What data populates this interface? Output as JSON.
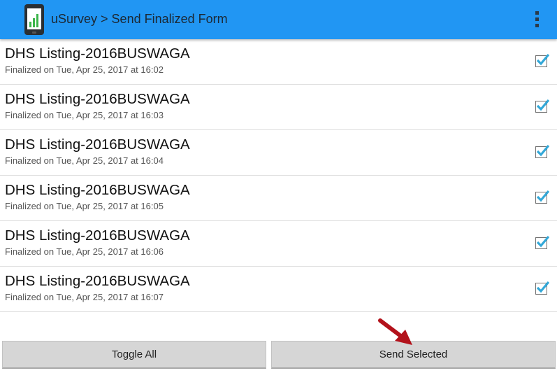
{
  "appbar": {
    "title": "uSurvey > Send Finalized Form",
    "logo_icon": "phone-chart-icon",
    "menu_icon": "overflow-menu-icon",
    "color": "#2196f3"
  },
  "forms": [
    {
      "title": "DHS Listing-2016BUSWAGA",
      "subtitle": "Finalized on Tue, Apr 25, 2017 at 16:02",
      "checked": true
    },
    {
      "title": "DHS Listing-2016BUSWAGA",
      "subtitle": "Finalized on Tue, Apr 25, 2017 at 16:03",
      "checked": true
    },
    {
      "title": "DHS Listing-2016BUSWAGA",
      "subtitle": "Finalized on Tue, Apr 25, 2017 at 16:04",
      "checked": true
    },
    {
      "title": "DHS Listing-2016BUSWAGA",
      "subtitle": "Finalized on Tue, Apr 25, 2017 at 16:05",
      "checked": true
    },
    {
      "title": "DHS Listing-2016BUSWAGA",
      "subtitle": "Finalized on Tue, Apr 25, 2017 at 16:06",
      "checked": true
    },
    {
      "title": "DHS Listing-2016BUSWAGA",
      "subtitle": "Finalized on Tue, Apr 25, 2017 at 16:07",
      "checked": true
    }
  ],
  "buttons": {
    "toggle_all": "Toggle All",
    "send_selected": "Send Selected"
  },
  "colors": {
    "check": "#33a8d8",
    "arrow": "#b3121b",
    "button_bg": "#d6d6d6"
  }
}
